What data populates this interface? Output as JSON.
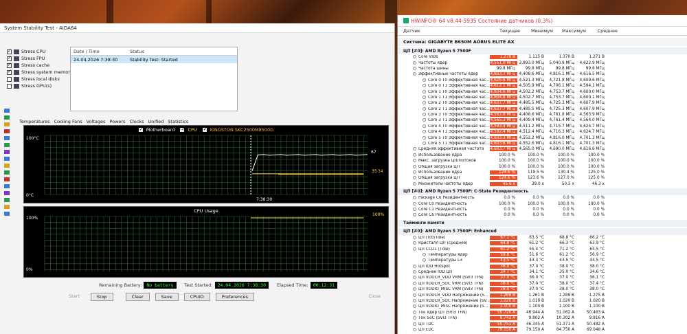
{
  "aida": {
    "title": "System Stability Test - AIDA64",
    "options": [
      {
        "label": "Stress CPU",
        "checked": true
      },
      {
        "label": "Stress FPU",
        "checked": true
      },
      {
        "label": "Stress cache",
        "checked": true
      },
      {
        "label": "Stress system memory",
        "checked": true
      },
      {
        "label": "Stress local disks",
        "checked": false
      },
      {
        "label": "Stress GPU(s)",
        "checked": false
      }
    ],
    "log": {
      "col_datetime": "Date / Time",
      "col_status": "Status",
      "row_datetime": "24.04.2026 7:38:30",
      "row_status": "Stability Test: Started"
    },
    "tabs": [
      "Temperatures",
      "Cooling Fans",
      "Voltages",
      "Powers",
      "Clocks",
      "Unified",
      "Statistics"
    ],
    "temp_graph": {
      "legend": [
        "Motherboard",
        "CPU",
        "KINGSTON SKC2500M8500G"
      ],
      "y_top": "100°C",
      "y_bottom": "0°C",
      "time_label": "7:38:30",
      "val_cpu": "67",
      "val_mb": "35",
      "val_ssd": "34"
    },
    "cpu_graph": {
      "title": "CPU Usage",
      "y_top": "100%",
      "y_bottom": "0%",
      "val": "100%"
    },
    "status": {
      "battery_label": "Remaining Battery:",
      "battery_value": "No battery",
      "started_label": "Test Started:",
      "started_value": "24.04.2026 7:38:30",
      "elapsed_label": "Elapsed Time:",
      "elapsed_value": "00:12:31"
    },
    "buttons": {
      "start": "Start",
      "stop": "Stop",
      "clear": "Clear",
      "save": "Save",
      "cpuid": "CPUID",
      "preferences": "Preferences",
      "close": "Close"
    },
    "colors": {
      "motherboard": "#ffffff",
      "cpu": "#ffe14d",
      "ssd": "#ffb347",
      "cpu_usage": "#ffe14d",
      "grid": "#2f6a2f"
    }
  },
  "hwinfo": {
    "title": "HWiNFO® 64 v8.44-5935 Состояние датчиков (0.3%)",
    "columns": [
      "Датчик",
      "Текущее",
      "Минимум",
      "Максимум",
      "Среднее"
    ],
    "rows": [
      {
        "type": "sect",
        "name": "Система: GIGABYTE B650M AORUS ELITE AX"
      },
      {
        "type": "grp",
        "name": "ЦП [#0]: AMD Ryzen 5 7500F"
      },
      {
        "type": "row",
        "lvl": 1,
        "name": "Core VIDs",
        "cur": "1.278 В",
        "min": "1.115 В",
        "max": "1.370 В",
        "avg": "1.271 В",
        "hot": true
      },
      {
        "type": "row",
        "lvl": 1,
        "name": "Частоты ядер",
        "cur": "4,551.0 МГц",
        "min": "3,893.0 МГц",
        "max": "5,040.9 МГц",
        "avg": "4,622.9 МГц",
        "hot": true
      },
      {
        "type": "row",
        "lvl": 1,
        "name": "Частота шины",
        "cur": "99.8 МГц",
        "min": "99.8 МГц",
        "max": "99.8 МГц",
        "avg": "99.8 МГц",
        "hot": false
      },
      {
        "type": "row",
        "lvl": 1,
        "name": "Эффективные частоты ядер",
        "cur": "4,603.7 МГц",
        "min": "4,408.6 МГц",
        "max": "4,816.1 МГц",
        "avg": "4,616.5 МГц",
        "hot": true
      },
      {
        "type": "row",
        "lvl": 2,
        "name": "Core 0 T0 Эффективная час...",
        "cur": "4,626.6 МГц",
        "min": "4,521.3 МГц",
        "max": "4,721.8 МГц",
        "avg": "4,609.6 МГц",
        "hot": true
      },
      {
        "type": "row",
        "lvl": 2,
        "name": "Core 0 T1 Эффективная час...",
        "cur": "4,612.1 МГц",
        "min": "4,505.9 МГц",
        "max": "4,706.1 МГц",
        "avg": "4,594.1 МГц",
        "hot": true
      },
      {
        "type": "row",
        "lvl": 2,
        "name": "Core 1 T0 Эффективная час...",
        "cur": "4,604.6 МГц",
        "min": "4,502.2 МГц",
        "max": "4,753.7 МГц",
        "avg": "4,600.0 МГц",
        "hot": true
      },
      {
        "type": "row",
        "lvl": 2,
        "name": "Core 1 T1 Эффективная час...",
        "cur": "4,604.8 МГц",
        "min": "4,502.7 МГц",
        "max": "4,753.7 МГц",
        "avg": "4,600.1 МГц",
        "hot": true
      },
      {
        "type": "row",
        "lvl": 2,
        "name": "Core 2 T0 Эффективная час...",
        "cur": "4,637.7 МГц",
        "min": "4,485.5 МГц",
        "max": "4,725.3 МГц",
        "avg": "4,607.9 МГц",
        "hot": true
      },
      {
        "type": "row",
        "lvl": 2,
        "name": "Core 2 T1 Эффективная час...",
        "cur": "4,637.7 МГц",
        "min": "4,485.5 МГц",
        "max": "4,725.3 МГц",
        "avg": "4,607.9 МГц",
        "hot": true
      },
      {
        "type": "row",
        "lvl": 2,
        "name": "Core 3 T0 Эффективная час...",
        "cur": "4,562.8 МГц",
        "min": "4,408.6 МГц",
        "max": "4,761.8 МГц",
        "avg": "4,563.9 МГц",
        "hot": true
      },
      {
        "type": "row",
        "lvl": 2,
        "name": "Core 3 T1 Эффективная час...",
        "cur": "4,565.3 МГц",
        "min": "4,409.4 МГц",
        "max": "4,761.4 МГц",
        "avg": "4,564.0 МГц",
        "hot": true
      },
      {
        "type": "row",
        "lvl": 2,
        "name": "Core 4 T0 Эффективная час...",
        "cur": "4,593.4 МГц",
        "min": "4,511.2 МГц",
        "max": "4,715.7 МГц",
        "avg": "4,624.7 МГц",
        "hot": true
      },
      {
        "type": "row",
        "lvl": 2,
        "name": "Core 4 T1 Эффективная час...",
        "cur": "4,592.4 МГц",
        "min": "4,512.4 МГц",
        "max": "4,716.3 МГц",
        "avg": "4,624.7 МГц",
        "hot": true
      },
      {
        "type": "row",
        "lvl": 2,
        "name": "Core 5 T0 Эффективная час...",
        "cur": "4,603.3 МГц",
        "min": "4,552.2 МГц",
        "max": "4,816.0 МГц",
        "avg": "4,701.3 МГц",
        "hot": true
      },
      {
        "type": "row",
        "lvl": 2,
        "name": "Core 5 T1 Эффективная час...",
        "cur": "4,603.6 МГц",
        "min": "4,552.6 МГц",
        "max": "4,816.1 МГц",
        "avg": "4,701.3 МГц",
        "hot": true
      },
      {
        "type": "row",
        "lvl": 1,
        "name": "Средняя эффективная частота",
        "cur": "4,603.7 МГц",
        "min": "4,565.0 МГц",
        "max": "4,690.0 МГц",
        "avg": "4,616.6 МГц",
        "hot": true
      },
      {
        "type": "row",
        "lvl": 1,
        "name": "Использование ядра",
        "cur": "100.0 %",
        "min": "100.0 %",
        "max": "100.0 %",
        "avg": "100.0 %",
        "hot": false
      },
      {
        "type": "row",
        "lvl": 1,
        "name": "Макс. загрузка ЦП/Потоков",
        "cur": "100.0 %",
        "min": "100.0 %",
        "max": "100.0 %",
        "avg": "100.0 %",
        "hot": false
      },
      {
        "type": "row",
        "lvl": 1,
        "name": "Общая загрузка ЦП",
        "cur": "100.0 %",
        "min": "100.0 %",
        "max": "100.0 %",
        "avg": "100.0 %",
        "hot": false
      },
      {
        "type": "row",
        "lvl": 1,
        "name": "Использование ядра",
        "cur": "124.6 %",
        "min": "119.5 %",
        "max": "130.4 %",
        "avg": "125.0 %",
        "hot": true
      },
      {
        "type": "row",
        "lvl": 1,
        "name": "Общая загрузка ЦП",
        "cur": "124.6 %",
        "min": "123.6 %",
        "max": "127.0 %",
        "avg": "125.0 %",
        "hot": true
      },
      {
        "type": "row",
        "lvl": 1,
        "name": "Множители частоты ядер",
        "cur": "45.6 x",
        "min": "39.0 x",
        "max": "50.5 x",
        "avg": "46.3 x",
        "hot": true
      },
      {
        "type": "grp",
        "name": "ЦП [#0]: AMD Ryzen 5 7500F: C-State Резидентность"
      },
      {
        "type": "row",
        "lvl": 1,
        "name": "Package C6 Резидентность",
        "cur": "0.0 %",
        "min": "0.0 %",
        "max": "0.0 %",
        "avg": "0.0 %",
        "hot": false
      },
      {
        "type": "row",
        "lvl": 1,
        "name": "Core C0 Резидентность",
        "cur": "100.0 %",
        "min": "100.0 %",
        "max": "100.0 %",
        "avg": "100.0 %",
        "hot": false
      },
      {
        "type": "row",
        "lvl": 1,
        "name": "Core C1 Резидентность",
        "cur": "0.0 %",
        "min": "0.0 %",
        "max": "0.0 %",
        "avg": "0.0 %",
        "hot": false
      },
      {
        "type": "row",
        "lvl": 1,
        "name": "Core C6 Резидентность",
        "cur": "0.0 %",
        "min": "0.0 %",
        "max": "0.0 %",
        "avg": "0.0 %",
        "hot": false
      },
      {
        "type": "grp",
        "name": "Тайминги памяти"
      },
      {
        "type": "grp",
        "name": "ЦП [#0]: AMD Ryzen 5 7500F: Enhanced"
      },
      {
        "type": "row",
        "lvl": 1,
        "name": "ЦП (Tctl/Tdie)",
        "cur": "67.1 °C",
        "min": "63.5 °C",
        "max": "68.8 °C",
        "avg": "66.2 °C",
        "hot": true
      },
      {
        "type": "row",
        "lvl": 1,
        "name": "Кристалл ЦП (среднее)",
        "cur": "64.8 °C",
        "min": "61.2 °C",
        "max": "66.3 °C",
        "avg": "63.9 °C",
        "hot": true
      },
      {
        "type": "row",
        "lvl": 1,
        "name": "ЦП CCD1 (Tdie)",
        "cur": "61.2 °C",
        "min": "55.4 °C",
        "max": "71.2 °C",
        "avg": "63.5 °C",
        "hot": true
      },
      {
        "type": "row",
        "lvl": 2,
        "name": "Температуры ядер",
        "cur": "59.8 °C",
        "min": "51.6 °C",
        "max": "61.2 °C",
        "avg": "56.9 °C",
        "hot": true
      },
      {
        "type": "row",
        "lvl": 2,
        "name": "Температуры L3",
        "cur": "43.5 °C",
        "min": "43.3 °C",
        "max": "43.5 °C",
        "avg": "43.5 °C",
        "hot": true
      },
      {
        "type": "row",
        "lvl": 1,
        "name": "ЦП IOD Hotspot",
        "cur": "38.0 °C",
        "min": "37.0 °C",
        "max": "38.0 °C",
        "avg": "38.0 °C",
        "hot": true
      },
      {
        "type": "row",
        "lvl": 1,
        "name": "Среднее IOD ЦП",
        "cur": "34.7 °C",
        "min": "34.1 °C",
        "max": "35.0 °C",
        "avg": "34.6 °C",
        "hot": true
      },
      {
        "type": "row",
        "lvl": 1,
        "name": "ЦП VDDCR_VDD VRM (SVI3 TFN)",
        "cur": "37.0 °C",
        "min": "36.0 °C",
        "max": "37.0 °C",
        "avg": "36.1 °C",
        "hot": true
      },
      {
        "type": "row",
        "lvl": 1,
        "name": "ЦП VDDCR_SOC VRM (SVI3 TFN)",
        "cur": "38.0 °C",
        "min": "37.0 °C",
        "max": "38.0 °C",
        "avg": "37.4 °C",
        "hot": true
      },
      {
        "type": "row",
        "lvl": 1,
        "name": "ЦП VDDIO_MISC VRM (SVI3 TFN)",
        "cur": "38.0 °C",
        "min": "37.0 °C",
        "max": "38.0 °C",
        "avg": "38.0 °C",
        "hot": true
      },
      {
        "type": "row",
        "lvl": 1,
        "name": "ЦП VDDCR_VDD Напряжение (SV...",
        "cur": "1.269 В",
        "min": "1.261 В",
        "max": "1.289 В",
        "avg": "1.275 В",
        "hot": true
      },
      {
        "type": "row",
        "lvl": 1,
        "name": "ЦП VDDCR_SOC Напряжение (SV...",
        "cur": "1.020 В",
        "min": "1.019 В",
        "max": "1.020 В",
        "avg": "1.020 В",
        "hot": true
      },
      {
        "type": "row",
        "lvl": 1,
        "name": "ЦП VDDIO_MISC Напряжение (SV...",
        "cur": "1.100 В",
        "min": "1.100 В",
        "max": "1.100 В",
        "avg": "1.100 В",
        "hot": true
      },
      {
        "type": "row",
        "lvl": 1,
        "name": "Ток ядер ЦП (SVI3 TFN)",
        "cur": "50.720 A",
        "min": "46.944 A",
        "max": "51.062 A",
        "avg": "50.463 A",
        "hot": true
      },
      {
        "type": "row",
        "lvl": 1,
        "name": "Ток SoC (SVI3 TFN)",
        "cur": "9.743 A",
        "min": "9.802 A",
        "max": "10.302 A",
        "avg": "9.816 A",
        "hot": true
      },
      {
        "type": "row",
        "lvl": 1,
        "name": "ЦП TDC",
        "cur": "50.751 A",
        "min": "46.345 A",
        "max": "51.371 A",
        "avg": "50.482 A",
        "hot": true
      },
      {
        "type": "row",
        "lvl": 1,
        "name": "ЦП EDC",
        "cur": "79.150 A",
        "min": "79.150 A",
        "max": "84.750 A",
        "avg": "69.048 A",
        "hot": true
      }
    ]
  }
}
